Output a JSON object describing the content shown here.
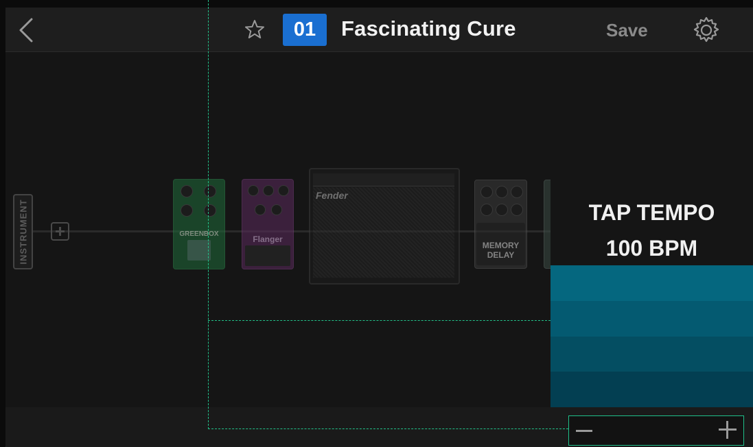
{
  "header": {
    "preset_number": "01",
    "preset_name": "Fascinating Cure",
    "save_label": "Save"
  },
  "signal_chain": {
    "input_label": "INSTRUMENT",
    "pedals": [
      {
        "name": "GREENBOX",
        "color": "#1f6b3a"
      },
      {
        "name": "Flanger",
        "color": "#5a2a5c"
      },
      {
        "name": "Fender",
        "color": "#2a2a2a"
      },
      {
        "name": "MEMORY DELAY",
        "color": "#3a3a3a"
      }
    ]
  },
  "tap_tempo": {
    "label": "TAP TEMPO",
    "bpm_text": "100 BPM",
    "bar_colors": [
      "#05677f",
      "#045a71",
      "#044e62",
      "#033f52"
    ]
  },
  "colors": {
    "accent_blue": "#1a6fd1",
    "guide_green": "#22c28a"
  }
}
